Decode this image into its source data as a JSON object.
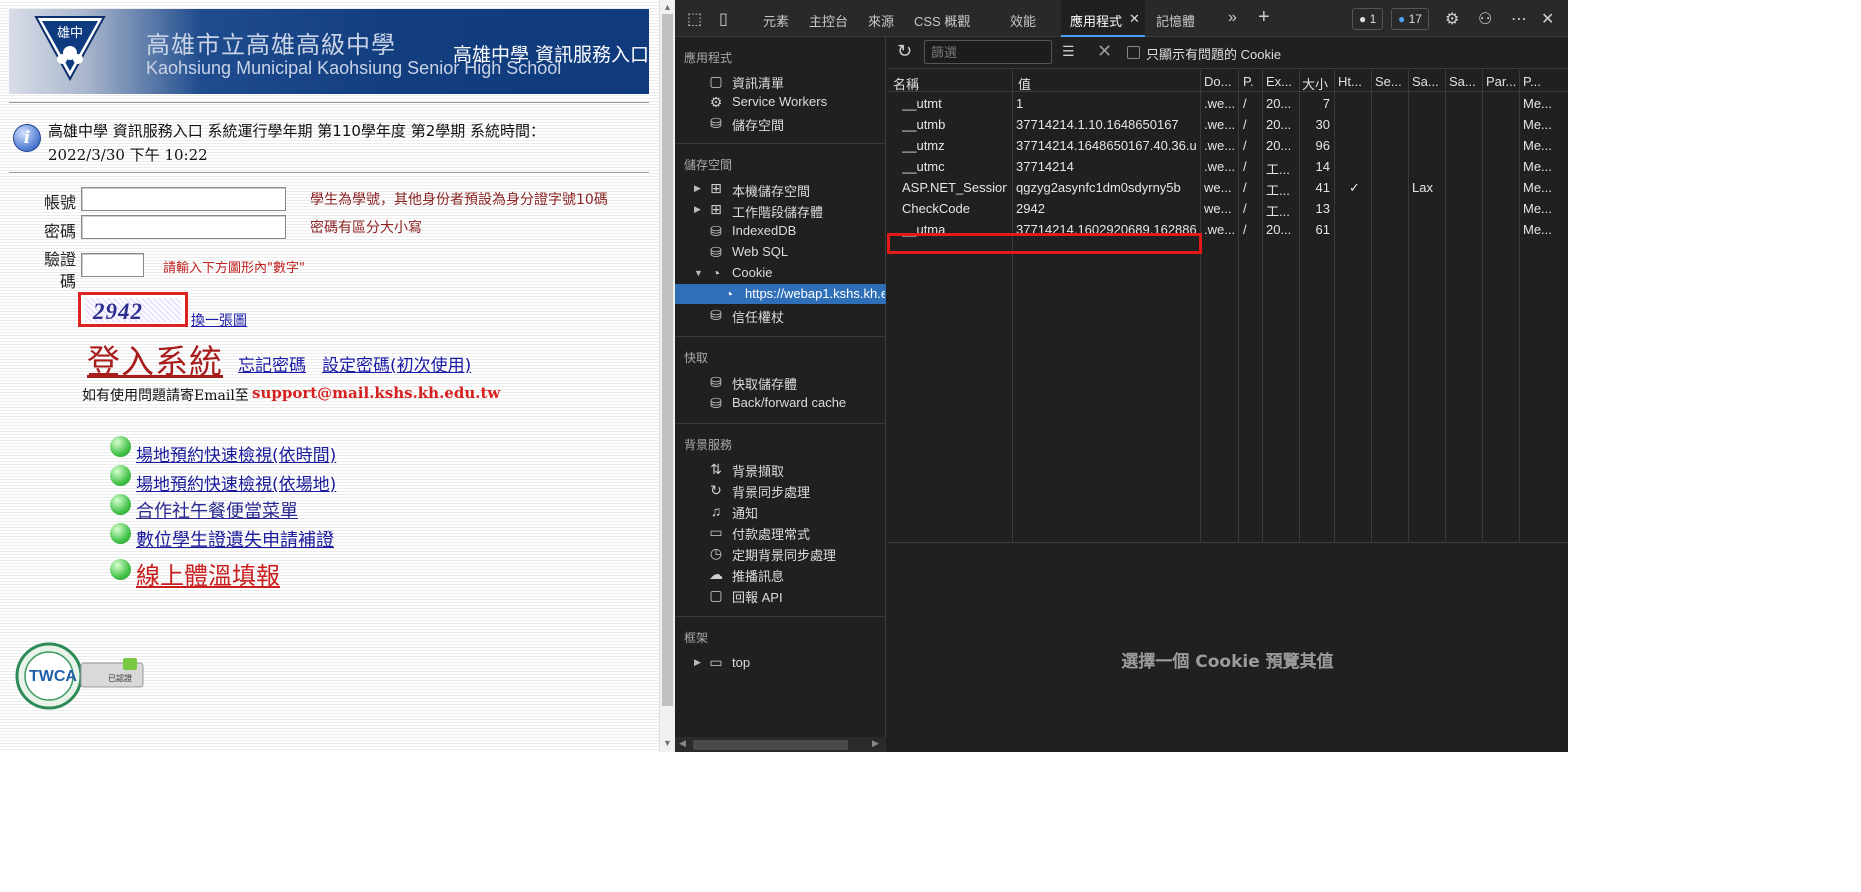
{
  "site": {
    "banner": {
      "school_cn": "高雄市立高雄高級中學",
      "school_en": "Kaohsiung Municipal Kaohsiung Senior High School",
      "portal": "高雄中學 資訊服務入口",
      "logo_text": "雄中"
    },
    "system": {
      "line1": "高雄中學 資訊服務入口 系統運行學年期 第110學年度 第2學期 系統時間：",
      "line2": "2022/3/30 下午 10:22"
    },
    "form": {
      "account_label": "帳號",
      "account_hint": "學生為學號，其他身份者預設為身分證字號10碼",
      "password_label": "密碼",
      "password_hint": "密碼有區分大小寫",
      "captcha_label_1": "驗證",
      "captcha_label_2": "碼",
      "captcha_hint": "請輸入下方圖形內\"數字\"",
      "captcha_value": "2942",
      "refresh_captcha": "換一張圖",
      "login": "登入系統",
      "forgot_password": "忘記密碼",
      "set_password": "設定密碼(初次使用)",
      "email_prefix": "如有使用問題請寄Email至",
      "email": "support@mail.kshs.kh.edu.tw"
    },
    "quick_links": [
      "場地預約快速檢視(依時間)",
      "場地預約快速檢視(依場地)",
      "合作社午餐便當菜單",
      "數位學生證遺失申請補證",
      "線上體溫填報"
    ],
    "twca": {
      "text": "TWCA",
      "secured": "Secured by",
      "certified": "已認證"
    }
  },
  "devtools": {
    "tabs": [
      "元素",
      "主控台",
      "來源",
      "CSS 概觀",
      "效能",
      "應用程式",
      "記憶體"
    ],
    "active_tab": "應用程式",
    "badge_errors": "1",
    "badge_messages": "17",
    "sidebar": {
      "app_section": "應用程式",
      "app_items": [
        "資訊清單",
        "Service Workers",
        "儲存空間"
      ],
      "storage_section": "儲存空間",
      "storage_items": [
        "本機儲存空間",
        "工作階段儲存體",
        "IndexedDB",
        "Web SQL",
        "Cookie"
      ],
      "cookie_origin": "https://webap1.kshs.kh.ed",
      "trust_tokens": "信任權杖",
      "cache_section": "快取",
      "cache_items": [
        "快取儲存體",
        "Back/forward cache"
      ],
      "bg_section": "背景服務",
      "bg_items": [
        "背景擷取",
        "背景同步處理",
        "通知",
        "付款處理常式",
        "定期背景同步處理",
        "推播訊息",
        "回報 API"
      ],
      "frames_section": "框架",
      "frames_items": [
        "top"
      ]
    },
    "filter": {
      "placeholder": "篩選",
      "only_issues_label": "只顯示有問題的 Cookie"
    },
    "columns": [
      "名稱",
      "值",
      "Do...",
      "P.",
      "Ex...",
      "大小",
      "Ht...",
      "Se...",
      "Sa...",
      "Sa...",
      "Par...",
      "P..."
    ],
    "cookies": [
      {
        "name": "__utmt",
        "value": "1",
        "domain": ".we...",
        "path": "/",
        "expires": "20...",
        "size": "7",
        "http": "",
        "secure": "",
        "samesite": "",
        "party": "Me..."
      },
      {
        "name": "__utmb",
        "value": "37714214.1.10.1648650167",
        "domain": ".we...",
        "path": "/",
        "expires": "20...",
        "size": "30",
        "http": "",
        "secure": "",
        "samesite": "",
        "party": "Me..."
      },
      {
        "name": "__utmz",
        "value": "37714214.1648650167.40.36.u...",
        "domain": ".we...",
        "path": "/",
        "expires": "20...",
        "size": "96",
        "http": "",
        "secure": "",
        "samesite": "",
        "party": "Me..."
      },
      {
        "name": "__utmc",
        "value": "37714214",
        "domain": ".we...",
        "path": "/",
        "expires": "工...",
        "size": "14",
        "http": "",
        "secure": "",
        "samesite": "",
        "party": "Me..."
      },
      {
        "name": "ASP.NET_SessionId",
        "value": "qgzyg2asynfc1dm0sdyrny5b",
        "domain": "we...",
        "path": "/",
        "expires": "工...",
        "size": "41",
        "http": "✓",
        "secure": "",
        "samesite": "Lax",
        "party": "Me..."
      },
      {
        "name": "CheckCode",
        "value": "2942",
        "domain": "we...",
        "path": "/",
        "expires": "工...",
        "size": "13",
        "http": "",
        "secure": "",
        "samesite": "",
        "party": "Me..."
      },
      {
        "name": "__utma",
        "value": "37714214.1602920689.162886...",
        "domain": ".we...",
        "path": "/",
        "expires": "20...",
        "size": "61",
        "http": "",
        "secure": "",
        "samesite": "",
        "party": "Me..."
      }
    ],
    "preview_text": "選擇一個 Cookie 預覽其值"
  }
}
